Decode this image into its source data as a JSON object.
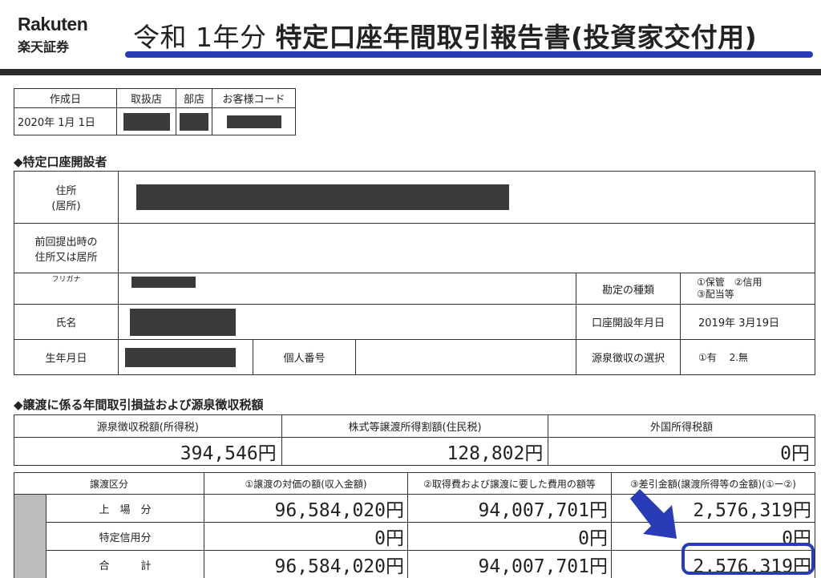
{
  "logo": {
    "line1": "Rakuten",
    "line2": "楽天証券"
  },
  "title": {
    "era": "令和  1年分",
    "main": "特定口座年間取引報告書(投資家交付用)"
  },
  "date_table": {
    "headers": [
      "作成日",
      "取扱店",
      "部店",
      "お客様コード"
    ],
    "created": "2020年 1月 1日"
  },
  "holder_section": {
    "heading": "◆特定口座開設者",
    "address_label_1": "住所",
    "address_label_2": "(居所)",
    "prev_address_label_1": "前回提出時の",
    "prev_address_label_2": "住所又は居所",
    "furigana_label": "フリガナ",
    "name_label": "氏名",
    "birth_label": "生年月日",
    "my_number_label": "個人番号",
    "account_type_label": "勘定の種類",
    "account_type_value_1": "①保管　②信用",
    "account_type_value_2": "③配当等",
    "opened_label": "口座開設年月日",
    "opened_value": "2019年  3月19日",
    "withholding_label": "源泉徴収の選択",
    "withholding_value": "①有　 2.無"
  },
  "summary_section": {
    "heading": "◆譲渡に係る年間取引損益および源泉徴収税額",
    "headers": [
      "源泉徴収税額(所得税)",
      "株式等譲渡所得割額(住民税)",
      "外国所得税額"
    ],
    "values": [
      "394,546円",
      "128,802円",
      "0円"
    ]
  },
  "detail_table": {
    "headers": [
      "譲渡区分",
      "①譲渡の対価の額(収入金額)",
      "②取得費および譲渡に要した費用の額等",
      "③差引金額(譲渡所得等の金額)(①ー②)"
    ],
    "rows": [
      {
        "label": "上　場　分",
        "c1": "96,584,020円",
        "c2": "94,007,701円",
        "c3": "2,576,319円"
      },
      {
        "label": "特定信用分",
        "c1": "0円",
        "c2": "0円",
        "c3": "0円"
      },
      {
        "label": "合　　　計",
        "c1": "96,584,020円",
        "c2": "94,007,701円",
        "c3": "2,576,319円"
      }
    ]
  },
  "accent_color": "#2a3bb8"
}
